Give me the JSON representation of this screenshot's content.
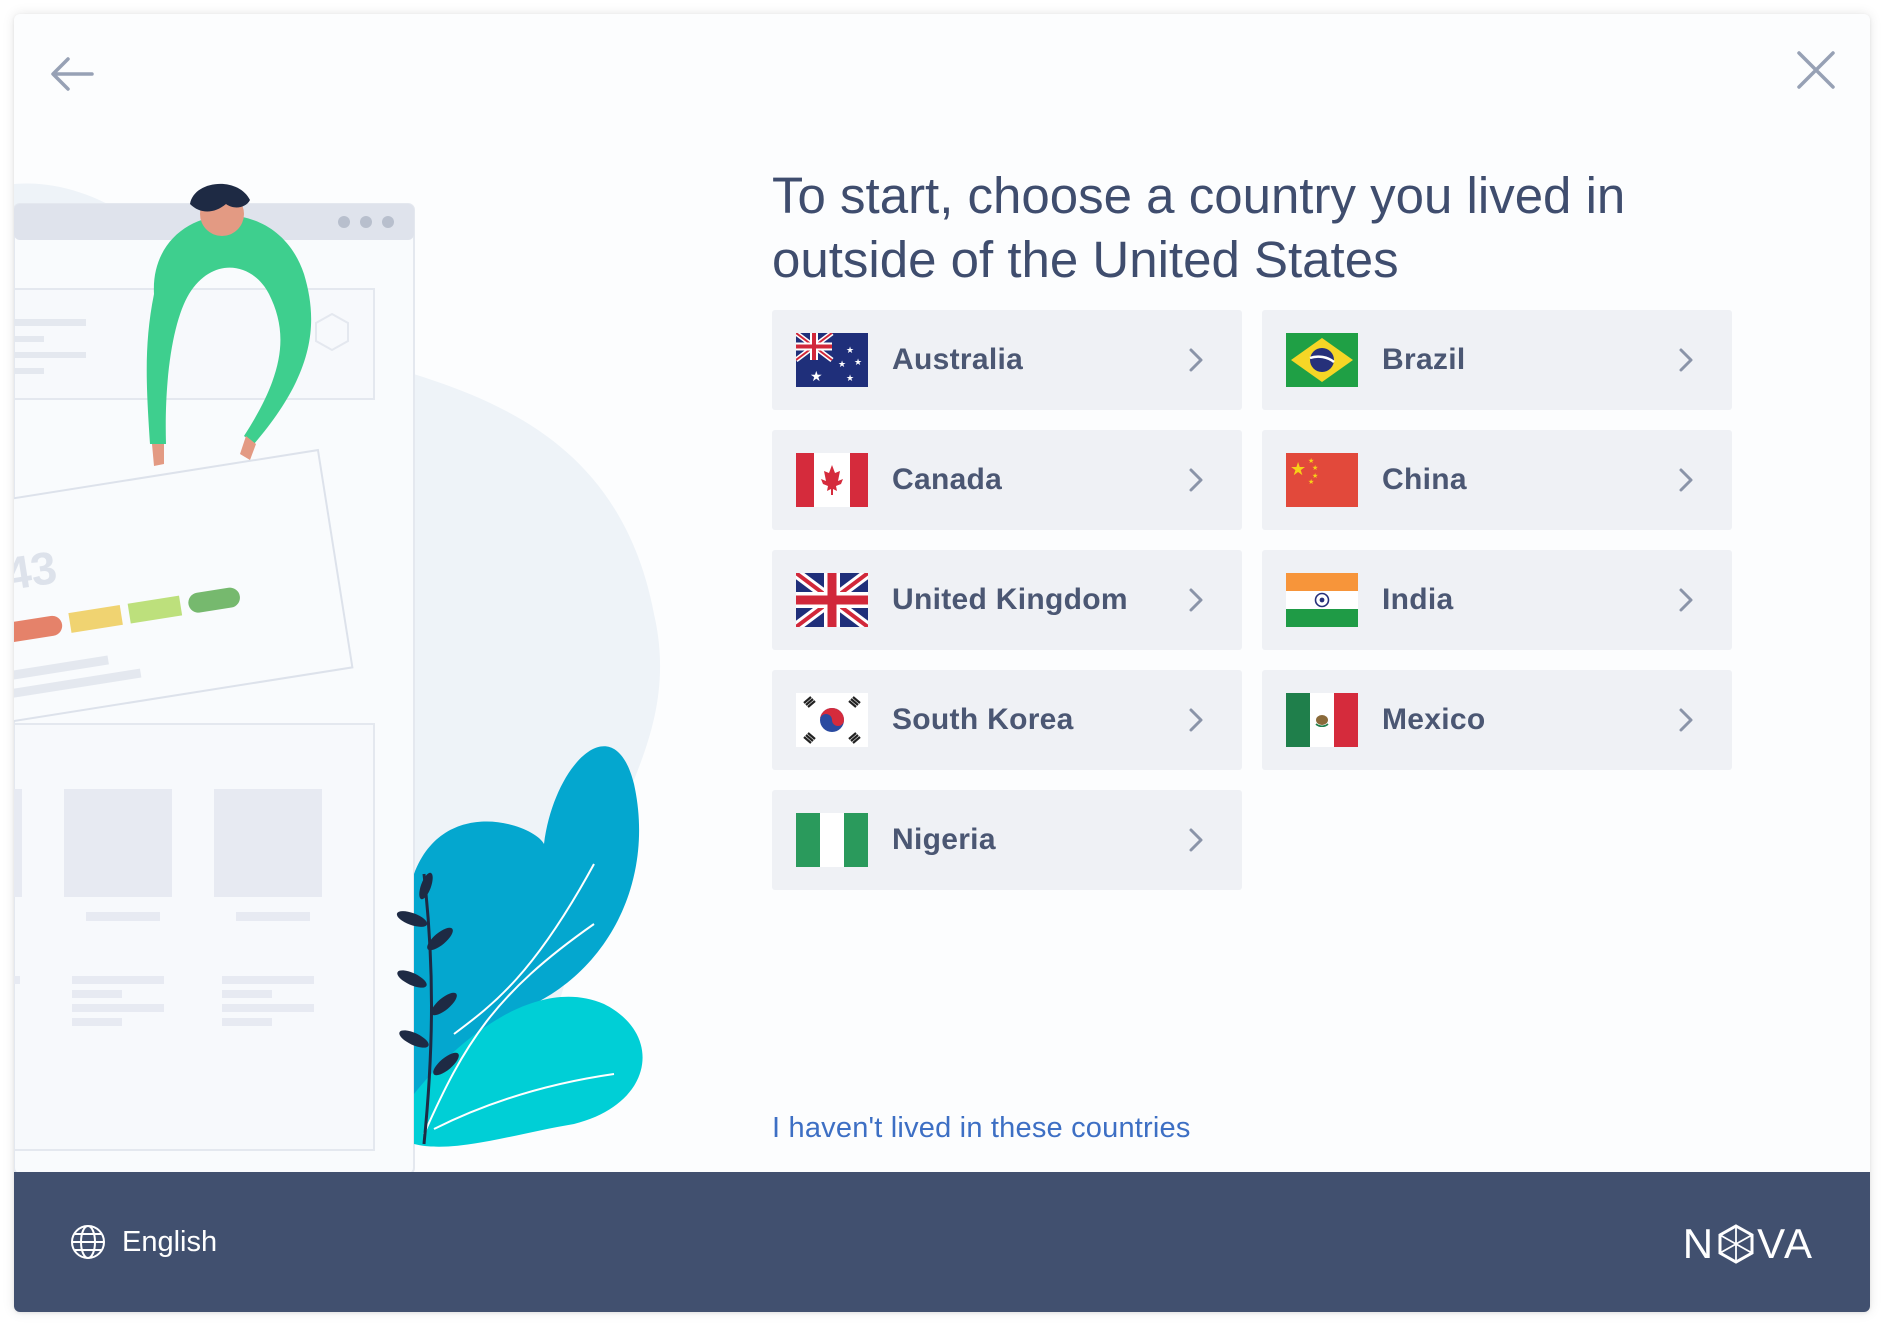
{
  "heading": "To start, choose a country you lived in outside of the United States",
  "countries": [
    {
      "name": "Australia"
    },
    {
      "name": "Brazil"
    },
    {
      "name": "Canada"
    },
    {
      "name": "China"
    },
    {
      "name": "United Kingdom"
    },
    {
      "name": "India"
    },
    {
      "name": "South Korea"
    },
    {
      "name": "Mexico"
    },
    {
      "name": "Nigeria"
    }
  ],
  "skip_link": "I haven't lived in these countries",
  "footer": {
    "language": "English",
    "brand_prefix": "N",
    "brand_suffix": "VA"
  },
  "illustration": {
    "score_text": "43"
  },
  "colors": {
    "heading": "#3f4d6e",
    "tile_bg": "#eff1f5",
    "link": "#3d6fc4",
    "footer_bg": "#41506f"
  },
  "icons": {
    "back": "arrow-left-icon",
    "close": "close-icon",
    "chevron": "chevron-right-icon",
    "globe": "globe-icon"
  }
}
